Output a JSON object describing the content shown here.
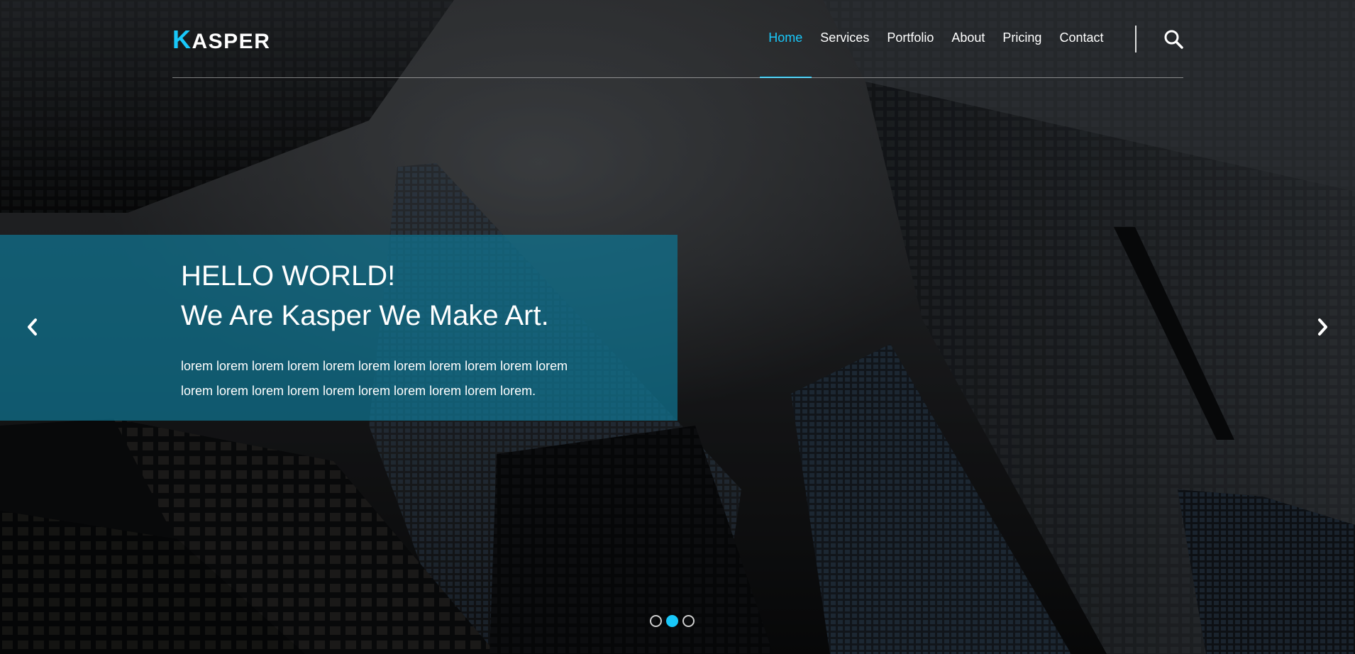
{
  "brand": {
    "logo_first_letter": "K",
    "logo_rest": "ASPER",
    "accent_color": "#19c8fa"
  },
  "nav": {
    "items": [
      {
        "label": "Home",
        "active": true
      },
      {
        "label": "Services",
        "active": false
      },
      {
        "label": "Portfolio",
        "active": false
      },
      {
        "label": "About",
        "active": false
      },
      {
        "label": "Pricing",
        "active": false
      },
      {
        "label": "Contact",
        "active": false
      }
    ],
    "search_icon": "search-icon"
  },
  "hero": {
    "title_line1": "HELLO WORLD!",
    "title_line2": "We Are Kasper We Make Art.",
    "description_line1": "lorem lorem lorem lorem lorem lorem lorem lorem lorem lorem lorem",
    "description_line2": "lorem lorem lorem lorem lorem lorem lorem lorem lorem lorem.",
    "caption_bg_color": "#0f7491"
  },
  "slider": {
    "prev_icon": "chevron-left-icon",
    "next_icon": "chevron-right-icon",
    "dots": [
      {
        "active": false
      },
      {
        "active": true
      },
      {
        "active": false
      }
    ]
  }
}
